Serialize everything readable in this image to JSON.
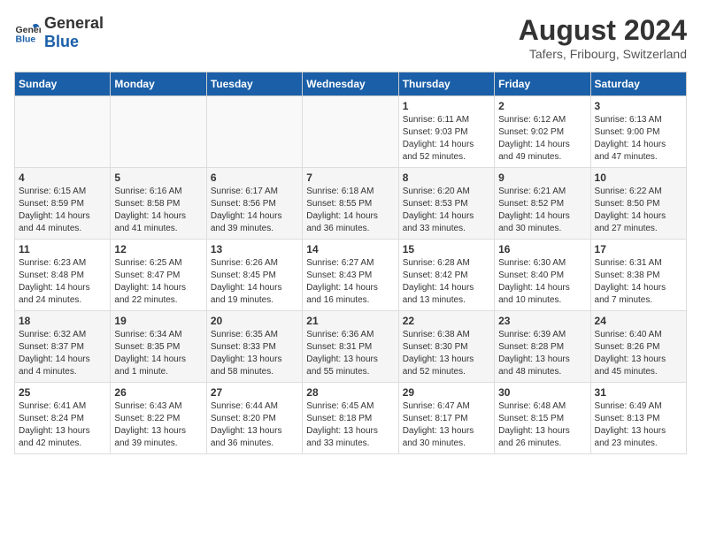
{
  "header": {
    "logo_general": "General",
    "logo_blue": "Blue",
    "month_year": "August 2024",
    "location": "Tafers, Fribourg, Switzerland"
  },
  "weekdays": [
    "Sunday",
    "Monday",
    "Tuesday",
    "Wednesday",
    "Thursday",
    "Friday",
    "Saturday"
  ],
  "weeks": [
    [
      {
        "day": "",
        "info": ""
      },
      {
        "day": "",
        "info": ""
      },
      {
        "day": "",
        "info": ""
      },
      {
        "day": "",
        "info": ""
      },
      {
        "day": "1",
        "info": "Sunrise: 6:11 AM\nSunset: 9:03 PM\nDaylight: 14 hours\nand 52 minutes."
      },
      {
        "day": "2",
        "info": "Sunrise: 6:12 AM\nSunset: 9:02 PM\nDaylight: 14 hours\nand 49 minutes."
      },
      {
        "day": "3",
        "info": "Sunrise: 6:13 AM\nSunset: 9:00 PM\nDaylight: 14 hours\nand 47 minutes."
      }
    ],
    [
      {
        "day": "4",
        "info": "Sunrise: 6:15 AM\nSunset: 8:59 PM\nDaylight: 14 hours\nand 44 minutes."
      },
      {
        "day": "5",
        "info": "Sunrise: 6:16 AM\nSunset: 8:58 PM\nDaylight: 14 hours\nand 41 minutes."
      },
      {
        "day": "6",
        "info": "Sunrise: 6:17 AM\nSunset: 8:56 PM\nDaylight: 14 hours\nand 39 minutes."
      },
      {
        "day": "7",
        "info": "Sunrise: 6:18 AM\nSunset: 8:55 PM\nDaylight: 14 hours\nand 36 minutes."
      },
      {
        "day": "8",
        "info": "Sunrise: 6:20 AM\nSunset: 8:53 PM\nDaylight: 14 hours\nand 33 minutes."
      },
      {
        "day": "9",
        "info": "Sunrise: 6:21 AM\nSunset: 8:52 PM\nDaylight: 14 hours\nand 30 minutes."
      },
      {
        "day": "10",
        "info": "Sunrise: 6:22 AM\nSunset: 8:50 PM\nDaylight: 14 hours\nand 27 minutes."
      }
    ],
    [
      {
        "day": "11",
        "info": "Sunrise: 6:23 AM\nSunset: 8:48 PM\nDaylight: 14 hours\nand 24 minutes."
      },
      {
        "day": "12",
        "info": "Sunrise: 6:25 AM\nSunset: 8:47 PM\nDaylight: 14 hours\nand 22 minutes."
      },
      {
        "day": "13",
        "info": "Sunrise: 6:26 AM\nSunset: 8:45 PM\nDaylight: 14 hours\nand 19 minutes."
      },
      {
        "day": "14",
        "info": "Sunrise: 6:27 AM\nSunset: 8:43 PM\nDaylight: 14 hours\nand 16 minutes."
      },
      {
        "day": "15",
        "info": "Sunrise: 6:28 AM\nSunset: 8:42 PM\nDaylight: 14 hours\nand 13 minutes."
      },
      {
        "day": "16",
        "info": "Sunrise: 6:30 AM\nSunset: 8:40 PM\nDaylight: 14 hours\nand 10 minutes."
      },
      {
        "day": "17",
        "info": "Sunrise: 6:31 AM\nSunset: 8:38 PM\nDaylight: 14 hours\nand 7 minutes."
      }
    ],
    [
      {
        "day": "18",
        "info": "Sunrise: 6:32 AM\nSunset: 8:37 PM\nDaylight: 14 hours\nand 4 minutes."
      },
      {
        "day": "19",
        "info": "Sunrise: 6:34 AM\nSunset: 8:35 PM\nDaylight: 14 hours\nand 1 minute."
      },
      {
        "day": "20",
        "info": "Sunrise: 6:35 AM\nSunset: 8:33 PM\nDaylight: 13 hours\nand 58 minutes."
      },
      {
        "day": "21",
        "info": "Sunrise: 6:36 AM\nSunset: 8:31 PM\nDaylight: 13 hours\nand 55 minutes."
      },
      {
        "day": "22",
        "info": "Sunrise: 6:38 AM\nSunset: 8:30 PM\nDaylight: 13 hours\nand 52 minutes."
      },
      {
        "day": "23",
        "info": "Sunrise: 6:39 AM\nSunset: 8:28 PM\nDaylight: 13 hours\nand 48 minutes."
      },
      {
        "day": "24",
        "info": "Sunrise: 6:40 AM\nSunset: 8:26 PM\nDaylight: 13 hours\nand 45 minutes."
      }
    ],
    [
      {
        "day": "25",
        "info": "Sunrise: 6:41 AM\nSunset: 8:24 PM\nDaylight: 13 hours\nand 42 minutes."
      },
      {
        "day": "26",
        "info": "Sunrise: 6:43 AM\nSunset: 8:22 PM\nDaylight: 13 hours\nand 39 minutes."
      },
      {
        "day": "27",
        "info": "Sunrise: 6:44 AM\nSunset: 8:20 PM\nDaylight: 13 hours\nand 36 minutes."
      },
      {
        "day": "28",
        "info": "Sunrise: 6:45 AM\nSunset: 8:18 PM\nDaylight: 13 hours\nand 33 minutes."
      },
      {
        "day": "29",
        "info": "Sunrise: 6:47 AM\nSunset: 8:17 PM\nDaylight: 13 hours\nand 30 minutes."
      },
      {
        "day": "30",
        "info": "Sunrise: 6:48 AM\nSunset: 8:15 PM\nDaylight: 13 hours\nand 26 minutes."
      },
      {
        "day": "31",
        "info": "Sunrise: 6:49 AM\nSunset: 8:13 PM\nDaylight: 13 hours\nand 23 minutes."
      }
    ]
  ]
}
